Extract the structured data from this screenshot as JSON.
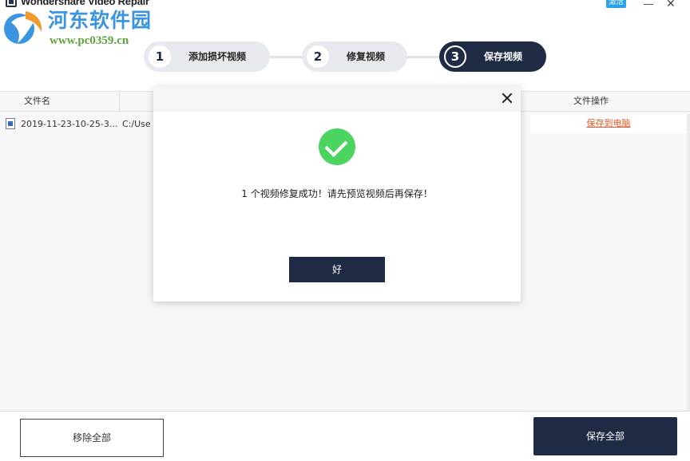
{
  "titlebar": {
    "app_title": "Wondershare Video Repair",
    "activate_label": "激活"
  },
  "watermark": {
    "site_name": "河东软件园",
    "site_url": "www.pc0359.cn"
  },
  "steps": [
    {
      "number": "1",
      "label": "添加损坏视频"
    },
    {
      "number": "2",
      "label": "修复视频"
    },
    {
      "number": "3",
      "label": "保存视频"
    }
  ],
  "table": {
    "columns": [
      "文件名",
      "文件操作"
    ],
    "rows": [
      {
        "name": "2019-11-23-10-25-3...",
        "path": "C:/Use",
        "action": "保存到电脑"
      }
    ]
  },
  "dialog": {
    "message": "1 个视频修复成功！请先预览视频后再保存！",
    "ok_label": "好"
  },
  "bottom": {
    "remove_all_label": "移除全部",
    "save_all_label": "保存全部"
  },
  "colors": {
    "primary_dark": "#1f2a44",
    "success_green": "#4cd460",
    "link_orange": "#e05a2a",
    "activate_blue": "#2aa2e6"
  }
}
